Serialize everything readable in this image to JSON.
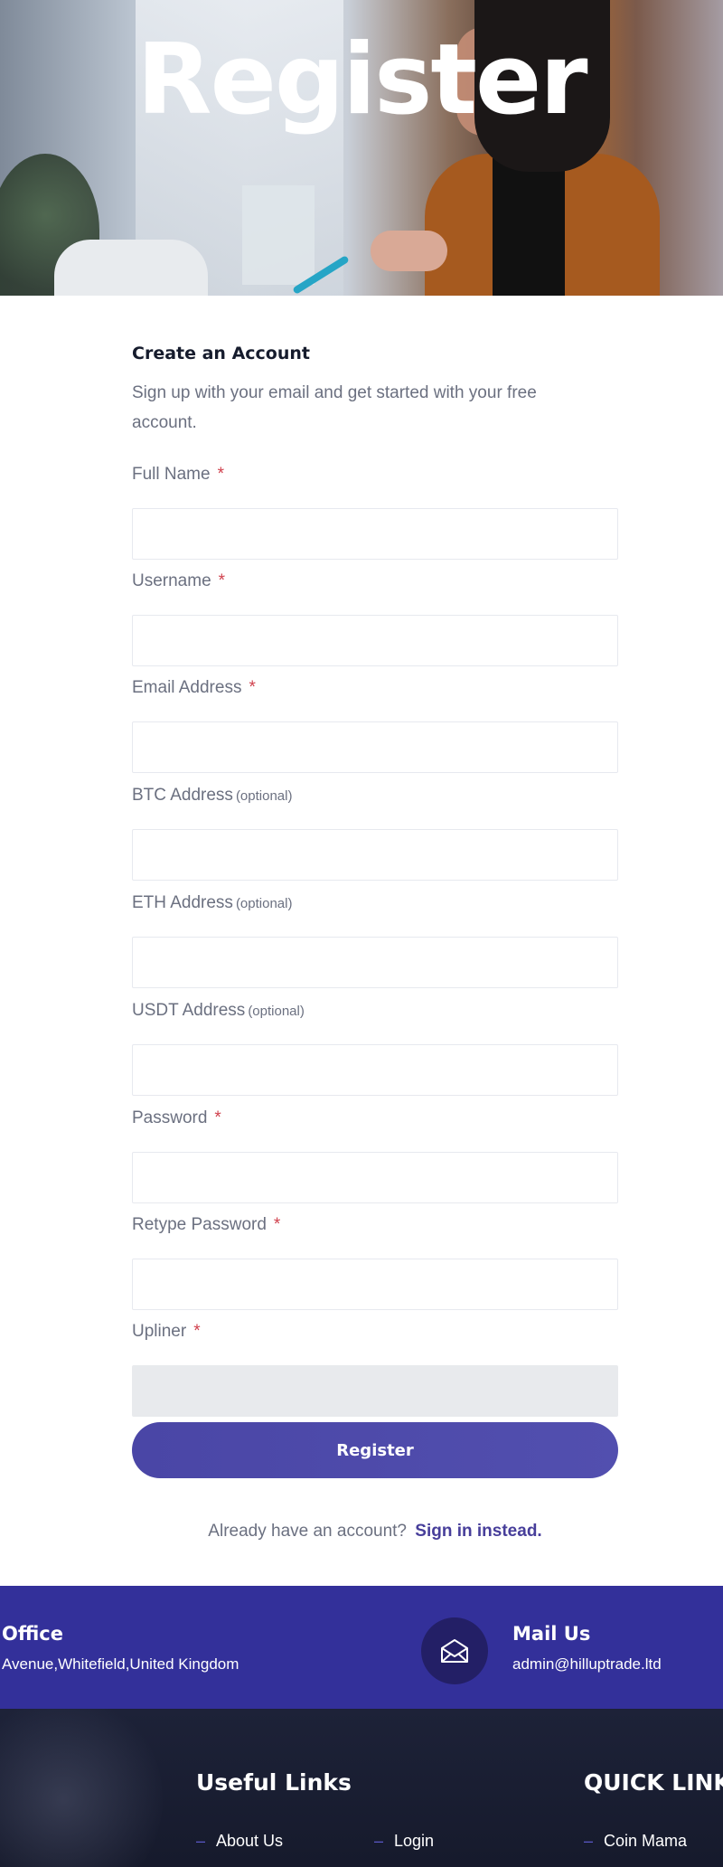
{
  "hero": {
    "title": "Register"
  },
  "form": {
    "title": "Create an Account",
    "subtitle": "Sign up with your email and get started with your free account.",
    "fields": [
      {
        "label": "Full Name",
        "required_mark": "*",
        "optional_note": ""
      },
      {
        "label": "Username",
        "required_mark": "*",
        "optional_note": ""
      },
      {
        "label": "Email Address",
        "required_mark": "*",
        "optional_note": ""
      },
      {
        "label": "BTC Address",
        "required_mark": "",
        "optional_note": "(optional)"
      },
      {
        "label": "ETH Address",
        "required_mark": "",
        "optional_note": "(optional)"
      },
      {
        "label": "USDT Address",
        "required_mark": "",
        "optional_note": "(optional)"
      },
      {
        "label": "Password",
        "required_mark": "*",
        "optional_note": ""
      },
      {
        "label": "Retype Password",
        "required_mark": "*",
        "optional_note": ""
      },
      {
        "label": "Upliner",
        "required_mark": "*",
        "optional_note": ""
      }
    ],
    "submit_label": "Register",
    "signin_prompt": "Already have an account?",
    "signin_link": "Sign in instead."
  },
  "contact": {
    "office_title": "Office",
    "office_text": "Avenue,Whitefield,United Kingdom",
    "mail_icon": "envelope-icon",
    "mail_title": "Mail Us",
    "mail_text": "admin@hilluptrade.ltd"
  },
  "footer": {
    "useful_links_title": "Useful Links",
    "quick_links_title": "QUICK LINKS",
    "useful_links": [
      "About Us",
      "Login"
    ],
    "quick_links": [
      "Coin Mama"
    ]
  },
  "colors": {
    "accent": "#4a46a6",
    "contact_band": "#33309a",
    "footer_bg": "#1d2238",
    "required": "#d0414d"
  }
}
